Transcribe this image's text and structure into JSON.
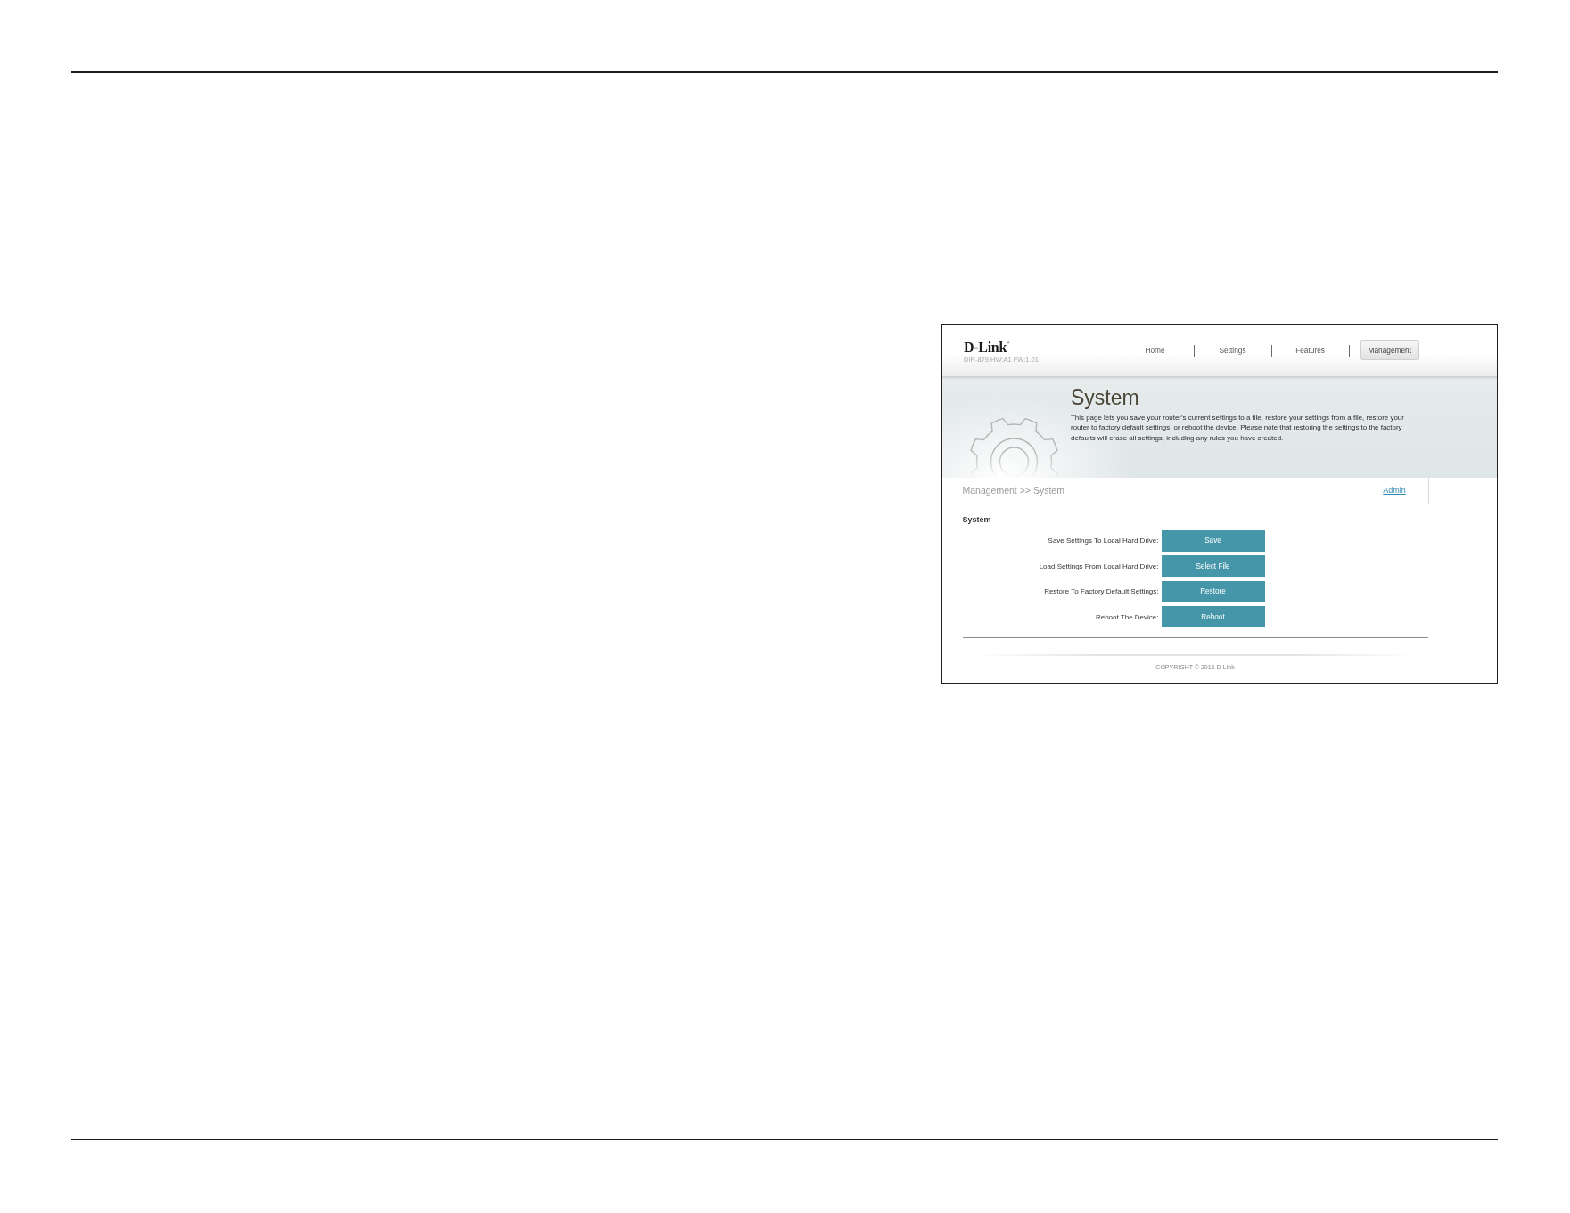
{
  "screenshot": {
    "header": {
      "logo": "D-Link$^{®}$",
      "model": "DIR-879 HW:A1 FW:1.01",
      "nav": [
        {
          "label": "Home",
          "selected": false
        },
        {
          "label": "Settings",
          "selected": false
        },
        {
          "label": "Features",
          "selected": false
        },
        {
          "label": "Management",
          "selected": true
        }
      ]
    },
    "banner": {
      "title": "System",
      "description": "This page lets you save your router's current settings to a file, restore your settings from a file, restore your router to factory default settings, or reboot the device. Please note that restoring the settings to the factory defaults will erase all settings, including any rules you have created."
    },
    "breadcrumb": "Management >> System",
    "account_link": "Admin",
    "section": {
      "title": "System",
      "rows": [
        {
          "label": "Save Settings To Local Hard Drive:",
          "button": "Save"
        },
        {
          "label": "Load Settings From Local Hard Drive:",
          "button": "Select File"
        },
        {
          "label": "Restore To Factory Default Settings:",
          "button": "Restore"
        },
        {
          "label": "Reboot The Device:",
          "button": "Reboot"
        }
      ]
    },
    "footer": {
      "copyright": "COPYRIGHT © 2015 D-Link"
    }
  }
}
